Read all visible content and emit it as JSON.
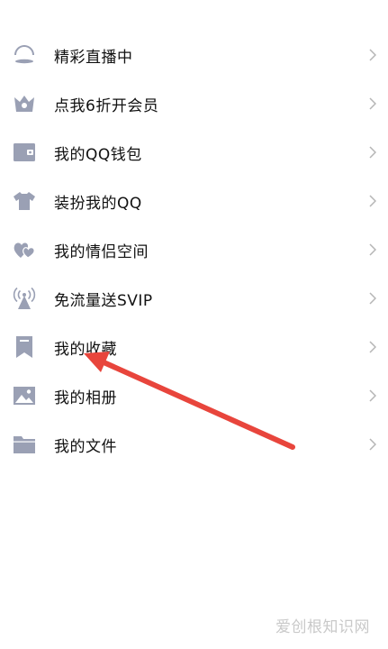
{
  "menu": {
    "items": [
      {
        "label": "精彩直播中",
        "icon": "live-dome-icon"
      },
      {
        "label": "点我6折开会员",
        "icon": "vip-crown-icon"
      },
      {
        "label": "我的QQ钱包",
        "icon": "wallet-icon"
      },
      {
        "label": "装扮我的QQ",
        "icon": "tshirt-icon"
      },
      {
        "label": "我的情侣空间",
        "icon": "couple-hearts-icon"
      },
      {
        "label": "免流量送SVIP",
        "icon": "signal-tower-icon"
      },
      {
        "label": "我的收藏",
        "icon": "bookmark-icon"
      },
      {
        "label": "我的相册",
        "icon": "photo-album-icon"
      },
      {
        "label": "我的文件",
        "icon": "folder-icon"
      }
    ],
    "chevron_icon": "chevron-right-icon"
  },
  "colors": {
    "icon": "#9aa0b4",
    "chevron": "#b5b5b5",
    "arrow": "#e8453c",
    "watermark": "#c9c9c9"
  },
  "watermark": "爱创根知识网"
}
